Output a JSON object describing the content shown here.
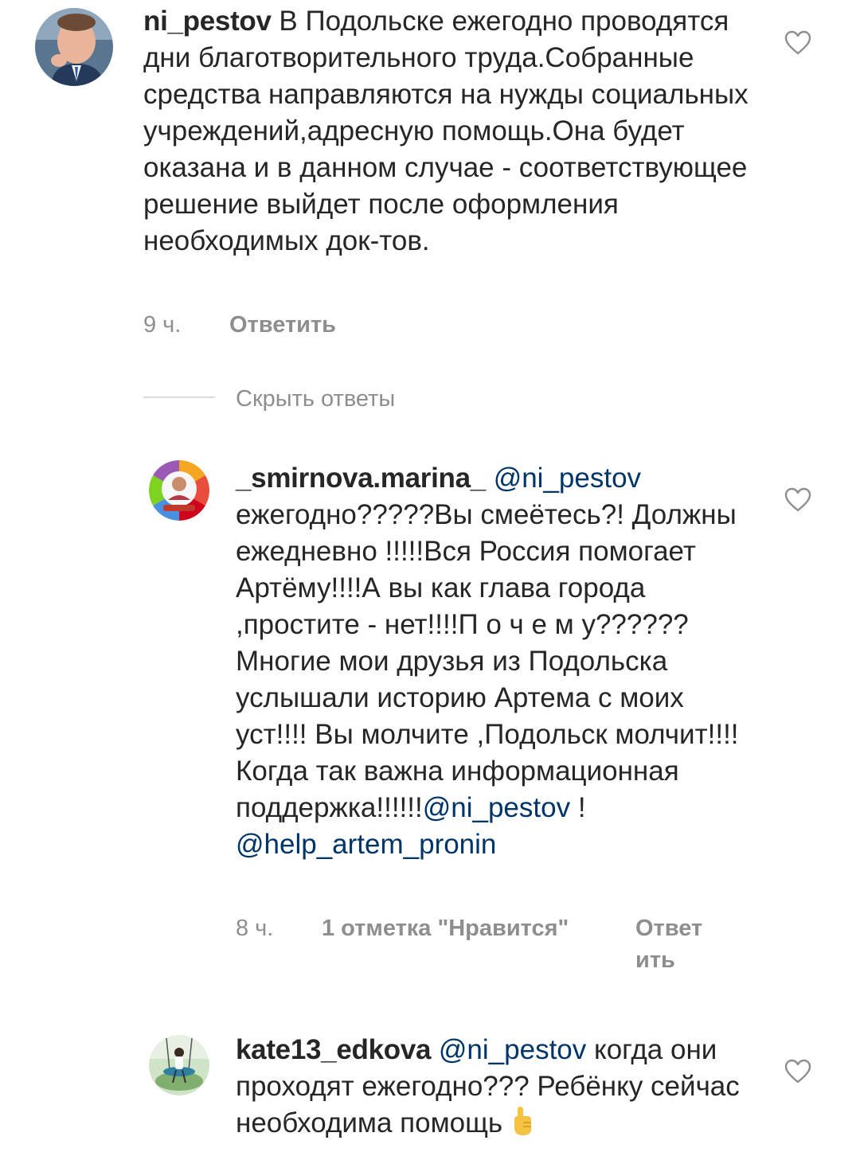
{
  "comments": [
    {
      "username": "ni_pestov",
      "mention": "",
      "body": "В Подольске ежегодно проводятся дни благотворительного труда.Собранные средства направляются на нужды социальных учреждений,адресную помощь.Она будет оказана и в данном случае - соответствующее решение выйдет после оформления необходимых док-тов.",
      "time": "9 ч.",
      "likes": "",
      "reply_label": "Ответить",
      "avatar_icon": "profile-photo-man"
    },
    {
      "username": "_smirnova.marina_",
      "mention": "@ni_pestov",
      "body": "ежегодно?????Вы смеётесь?! Должны ежедневно !!!!!Вся Россия помогает Артёму!!!!А вы как глава города ,простите - нет!!!!П о ч е м у??????Многие мои друзья из Подольска услышали историю Артема с моих уст!!!! Вы молчите ,Подольск молчит!!!! Когда так важна информационная поддержка!!!!!!",
      "mention2": "@ni_pestov",
      "body2": " !",
      "mention3": "@help_artem_pronin",
      "time": "8 ч.",
      "likes": "1 отметка \"Нравится\"",
      "reply_label_1": "Ответ",
      "reply_label_2": "ить",
      "avatar_icon": "profile-photo-colorful-logo"
    },
    {
      "username": "kate13_edkova",
      "mention": "@ni_pestov",
      "body": "когда они проходят ежегодно??? Ребёнку сейчас необходима помощь",
      "emoji": "pointing-up-hand-icon",
      "avatar_icon": "profile-photo-swing"
    }
  ],
  "hide_replies_label": "Скрыть ответы",
  "colors": {
    "text": "#262626",
    "mention": "#003569",
    "secondary": "#8e8e8e",
    "divider": "#dbdbdb"
  }
}
